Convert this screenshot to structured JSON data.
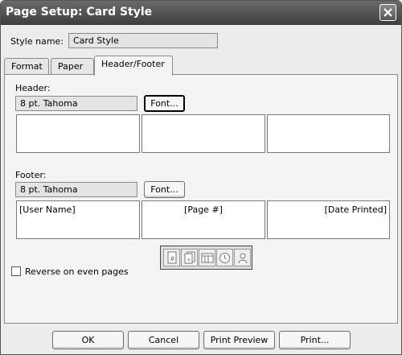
{
  "window": {
    "title": "Page Setup: Card Style"
  },
  "style_name": {
    "label": "Style name:",
    "value": "Card Style"
  },
  "tabs": [
    {
      "label": "Format",
      "active": false
    },
    {
      "label": "Paper",
      "active": false
    },
    {
      "label": "Header/Footer",
      "active": true
    }
  ],
  "header": {
    "label": "Header:",
    "font_value": "8 pt. Tahoma",
    "font_button": "Font...",
    "left": "",
    "center": "",
    "right": ""
  },
  "footer": {
    "label": "Footer:",
    "font_value": "8 pt. Tahoma",
    "font_button": "Font...",
    "left": "[User Name]",
    "center": "[Page #]",
    "right": "[Date Printed]"
  },
  "toolbar": {
    "icons": [
      "page-number-icon",
      "total-pages-icon",
      "date-icon",
      "time-icon",
      "user-name-icon"
    ]
  },
  "reverse_option": {
    "label": "Reverse on even pages",
    "checked": false
  },
  "buttons": {
    "ok": "OK",
    "cancel": "Cancel",
    "print_preview": "Print Preview",
    "print": "Print..."
  }
}
